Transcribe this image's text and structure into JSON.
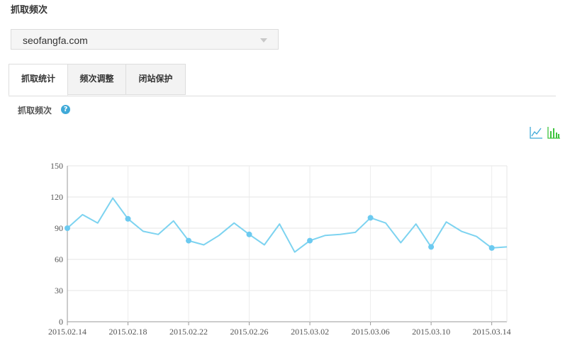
{
  "header": {
    "title": "抓取频次"
  },
  "site_select": {
    "value": "seofangfa.com"
  },
  "tabs": [
    {
      "label": "抓取统计",
      "active": true
    },
    {
      "label": "频次调整",
      "active": false
    },
    {
      "label": "闭站保护",
      "active": false
    }
  ],
  "section": {
    "label": "抓取频次",
    "help_icon": "question-circle-icon"
  },
  "toolbar": {
    "line_icon": "line-chart-icon",
    "bar_icon": "bar-chart-icon"
  },
  "colors": {
    "line": "#7dd3f0",
    "point": "#6ccaf0",
    "accent": "#3fa9d8",
    "bar_icon": "#3ec43e"
  },
  "chart_data": {
    "type": "line",
    "title": "",
    "xlabel": "",
    "ylabel": "",
    "ylim": [
      0,
      150
    ],
    "yticks": [
      0,
      30,
      60,
      90,
      120,
      150
    ],
    "x": [
      "2015.02.14",
      "2015.02.15",
      "2015.02.16",
      "2015.02.17",
      "2015.02.18",
      "2015.02.19",
      "2015.02.20",
      "2015.02.21",
      "2015.02.22",
      "2015.02.23",
      "2015.02.24",
      "2015.02.25",
      "2015.02.26",
      "2015.02.27",
      "2015.02.28",
      "2015.03.01",
      "2015.03.02",
      "2015.03.03",
      "2015.03.04",
      "2015.03.05",
      "2015.03.06",
      "2015.03.07",
      "2015.03.08",
      "2015.03.09",
      "2015.03.10",
      "2015.03.11",
      "2015.03.12",
      "2015.03.13",
      "2015.03.14",
      "2015.03.15"
    ],
    "xtick_labels": [
      "2015.02.14",
      "2015.02.18",
      "2015.02.22",
      "2015.02.26",
      "2015.03.02",
      "2015.03.06",
      "2015.03.10",
      "2015.03.14"
    ],
    "values": [
      90,
      103,
      95,
      119,
      99,
      87,
      84,
      97,
      78,
      74,
      83,
      95,
      84,
      74,
      94,
      67,
      78,
      83,
      84,
      86,
      100,
      95,
      76,
      94,
      72,
      96,
      87,
      82,
      71,
      72
    ],
    "grid": true
  }
}
